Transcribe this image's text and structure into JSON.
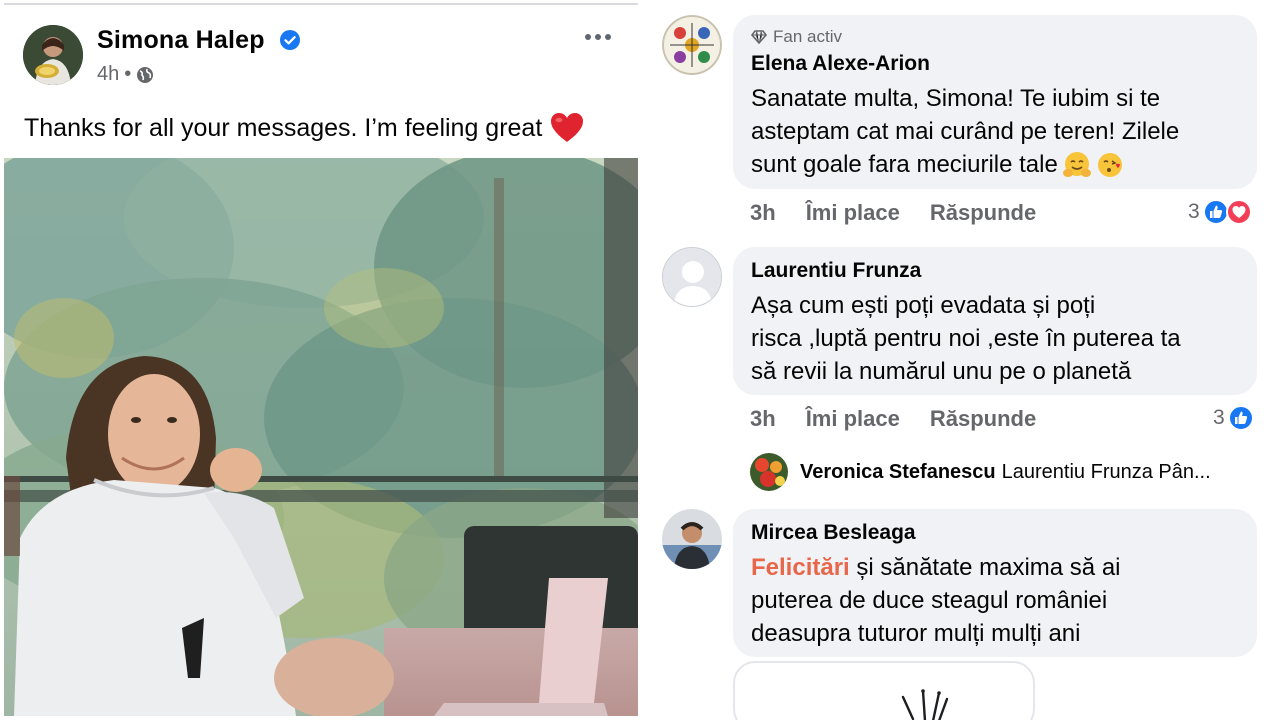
{
  "post": {
    "author": "Simona  Halep",
    "time": "4h",
    "separator": "•",
    "text": "Thanks for all your messages. I’m feeling great",
    "icons": {
      "avatar": "profile-photo",
      "verified": "verified-badge-icon",
      "privacy": "globe-icon",
      "menu": "more-horizontal-icon",
      "emoji": "red-heart-emoji"
    }
  },
  "comments": [
    {
      "badge": "Fan activ",
      "badge_icon": "diamond-icon",
      "name": "Elena Alexe-Arion",
      "lines": [
        "Sanatate multa, Simona! Te iubim si te",
        "asteptam cat mai curând pe teren! Zilele",
        "sunt goale fara meciurile tale"
      ],
      "emojis": [
        "hugging-face-emoji",
        "face-blowing-kiss-emoji"
      ],
      "time": "3h",
      "like": "Îmi place",
      "reply": "Răspunde",
      "reaction_count": "3",
      "reactions": [
        "like",
        "love"
      ]
    },
    {
      "name": "Laurentiu Frunza",
      "lines": [
        "Așa cum ești poți evadata și poți",
        "risca ,luptă pentru noi ,este în puterea ta",
        "să revii la numărul unu pe o planetă"
      ],
      "time": "3h",
      "like": "Îmi place",
      "reply": "Răspunde",
      "reaction_count": "3",
      "reactions": [
        "like"
      ],
      "reply_preview": {
        "name": "Veronica Stefanescu",
        "text": "Laurentiu Frunza Pân..."
      }
    },
    {
      "name": "Mircea Besleaga",
      "highlight": "Felicitări",
      "line1_rest": " și sănătate maxima să ai",
      "lines": [
        "puterea de duce steagul româniei",
        "deasupra tuturor mulți mulți ani"
      ]
    }
  ],
  "colors": {
    "facebook_blue": "#1877f2",
    "love_red": "#f33e58",
    "bubble_bg": "#f0f2f5",
    "secondary_text": "#65676b",
    "highlight_orange": "#e8674a"
  }
}
